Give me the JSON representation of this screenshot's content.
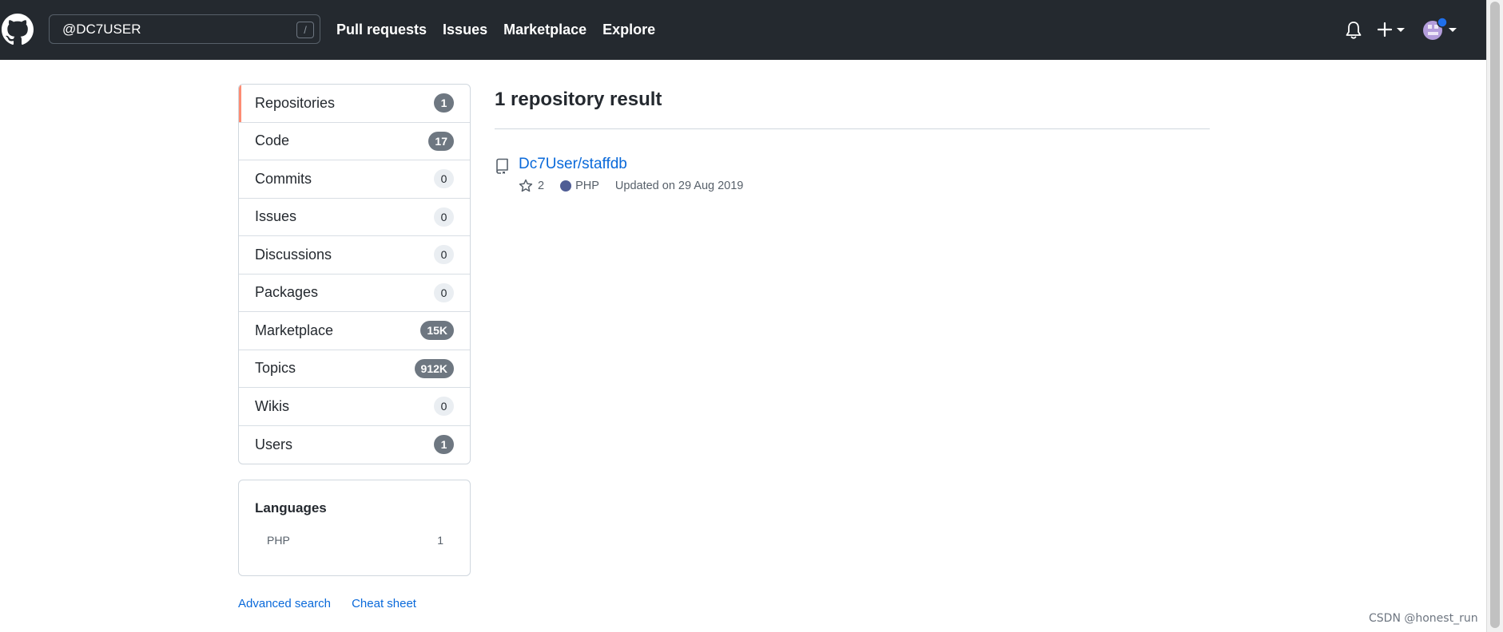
{
  "header": {
    "search": {
      "value": "@DC7USER",
      "shortcut": "/"
    },
    "nav": [
      "Pull requests",
      "Issues",
      "Marketplace",
      "Explore"
    ],
    "icons": [
      "github-logo",
      "bell-icon",
      "plus-icon",
      "avatar"
    ]
  },
  "sidebar": {
    "items": [
      {
        "label": "Repositories",
        "count": "1"
      },
      {
        "label": "Code",
        "count": "17"
      },
      {
        "label": "Commits",
        "count": "0"
      },
      {
        "label": "Issues",
        "count": "0"
      },
      {
        "label": "Discussions",
        "count": "0"
      },
      {
        "label": "Packages",
        "count": "0"
      },
      {
        "label": "Marketplace",
        "count": "15K"
      },
      {
        "label": "Topics",
        "count": "912K"
      },
      {
        "label": "Wikis",
        "count": "0"
      },
      {
        "label": "Users",
        "count": "1"
      }
    ],
    "languages": {
      "title": "Languages",
      "items": [
        {
          "name": "PHP",
          "count": "1"
        }
      ]
    },
    "links": {
      "advanced": "Advanced search",
      "cheat": "Cheat sheet"
    }
  },
  "results": {
    "title": "1 repository result",
    "repo": {
      "name": "Dc7User/staffdb",
      "stars": "2",
      "language": "PHP",
      "language_color": "#4f5d95",
      "updated": "Updated on 29 Aug 2019"
    }
  },
  "watermark": "CSDN @honest_run"
}
